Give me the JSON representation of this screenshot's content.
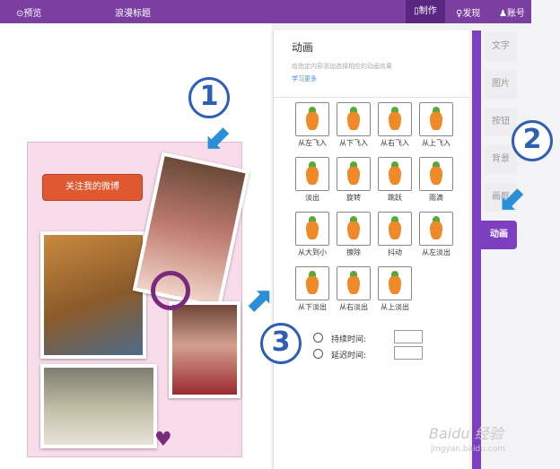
{
  "topbar": {
    "preview": "⊙预览",
    "title": "浪漫标题",
    "make": "▯制作",
    "discover": "♀发现",
    "account": "♟账号"
  },
  "canvas": {
    "follow_button": "关注我的微博"
  },
  "markers": {
    "n1": "1",
    "n2": "2",
    "n3": "3"
  },
  "panel": {
    "title": "动画",
    "description": "给指定内容添加选择相应的动画效果",
    "learn_more": "学习更多",
    "animations": [
      "从左飞入",
      "从下飞入",
      "从右飞入",
      "从上飞入",
      "淡出",
      "旋转",
      "跳跃",
      "雨滴",
      "从大到小",
      "擦除",
      "抖动",
      "从左淡出",
      "从下淡出",
      "从右淡出",
      "从上淡出"
    ],
    "duration_label": "持续时间:",
    "delay_label": "延迟时间:",
    "duration_value": "",
    "delay_value": ""
  },
  "side_tabs": {
    "text": "文字",
    "image": "图片",
    "button": "按钮",
    "background": "背景",
    "frame": "画框",
    "animation": "动画"
  },
  "watermark": {
    "main": "Baidu 经验",
    "sub": "jingyan.baidu.com"
  },
  "colors": {
    "topbar": "#7a3fa0",
    "accent": "#7b3fc0",
    "marker": "#2f5fb4",
    "arrow": "#2a8fd8"
  }
}
